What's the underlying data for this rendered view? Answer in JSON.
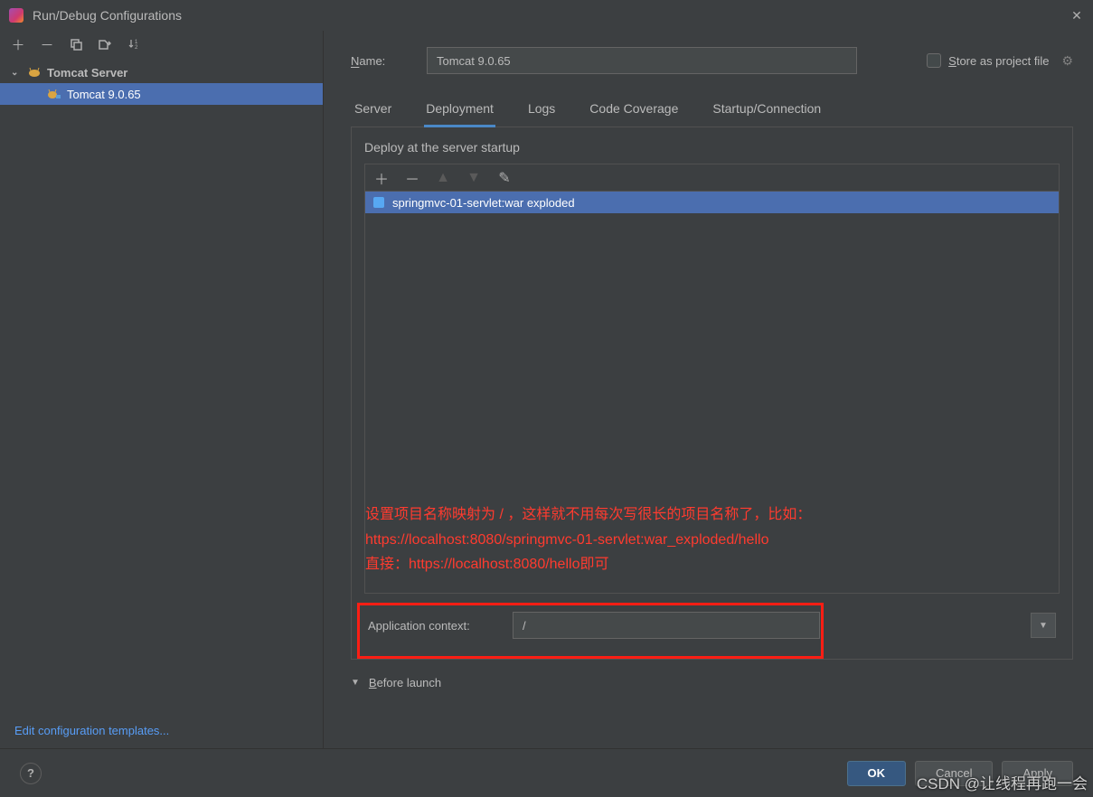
{
  "window": {
    "title": "Run/Debug Configurations"
  },
  "sidebar": {
    "root": {
      "label": "Tomcat Server"
    },
    "items": [
      {
        "label": "Tomcat 9.0.65"
      }
    ],
    "edit_templates": "Edit configuration templates..."
  },
  "form": {
    "name_label": "Name:",
    "name_value": "Tomcat 9.0.65",
    "store_label": "Store as project file"
  },
  "tabs": [
    {
      "label": "Server"
    },
    {
      "label": "Deployment",
      "active": true
    },
    {
      "label": "Logs"
    },
    {
      "label": "Code Coverage"
    },
    {
      "label": "Startup/Connection"
    }
  ],
  "deployment": {
    "section_label": "Deploy at the server startup",
    "items": [
      {
        "label": "springmvc-01-servlet:war exploded"
      }
    ],
    "annotation_line1": "设置项目名称映射为  /  ，这样就不用每次写很长的项目名称了，比如：",
    "annotation_line2": "https://localhost:8080/springmvc-01-servlet:war_exploded/hello",
    "annotation_line3": "直接：https://localhost:8080/hello即可",
    "app_context_label": "Application context:",
    "app_context_value": "/"
  },
  "before_launch": {
    "label": "Before launch"
  },
  "footer": {
    "ok": "OK",
    "cancel": "Cancel",
    "apply": "Apply"
  },
  "watermark": "CSDN @让线程再跑一会"
}
